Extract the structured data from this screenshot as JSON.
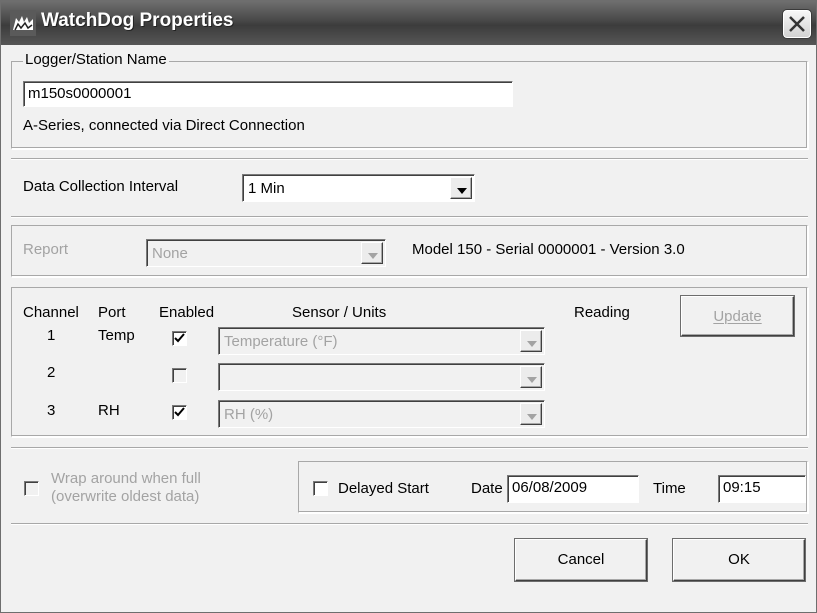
{
  "window": {
    "title": "WatchDog Properties"
  },
  "logger": {
    "group_label": "Logger/Station Name",
    "name_value": "m150s0000001",
    "connection_text": "A-Series, connected via Direct Connection"
  },
  "interval": {
    "label": "Data Collection Interval",
    "value": "1 Min"
  },
  "report": {
    "label": "Report",
    "value": "None",
    "model_text": "Model 150 - Serial 0000001 - Version 3.0"
  },
  "channels": {
    "headers": {
      "channel": "Channel",
      "port": "Port",
      "enabled": "Enabled",
      "sensor": "Sensor / Units",
      "reading": "Reading"
    },
    "update_label": "Update",
    "rows": [
      {
        "channel": "1",
        "port": "Temp",
        "enabled": true,
        "sensor": "Temperature (°F)"
      },
      {
        "channel": "2",
        "port": "",
        "enabled": false,
        "sensor": ""
      },
      {
        "channel": "3",
        "port": "RH",
        "enabled": true,
        "sensor": "RH (%)"
      }
    ]
  },
  "options": {
    "wrap_label_line1": "Wrap around when full",
    "wrap_label_line2": "(overwrite oldest data)",
    "delayed_start_label": "Delayed Start",
    "date_label": "Date",
    "date_value": "06/08/2009",
    "time_label": "Time",
    "time_value": "09:15"
  },
  "buttons": {
    "cancel": "Cancel",
    "ok": "OK"
  },
  "colors": {
    "dialog_bg": "#f1f1f1",
    "disabled_text": "#a3a3a3"
  }
}
